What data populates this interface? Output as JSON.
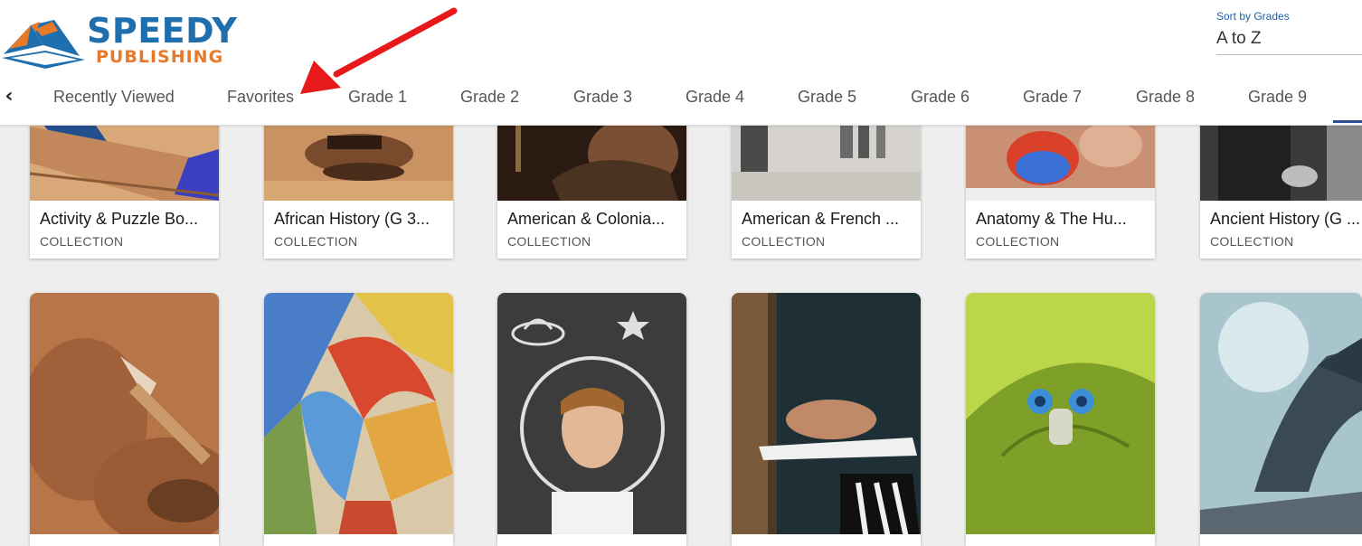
{
  "logo": {
    "line1": "SPEEDY",
    "line2": "PUBLISHING"
  },
  "sort": {
    "label": "Sort by Grades",
    "value": "A to Z"
  },
  "tabs": [
    "Recently Viewed",
    "Favorites",
    "Grade 1",
    "Grade 2",
    "Grade 3",
    "Grade 4",
    "Grade 5",
    "Grade 6",
    "Grade 7",
    "Grade 8",
    "Grade 9"
  ],
  "collections": [
    {
      "title": "Activity & Puzzle Bo...",
      "type": "COLLECTION"
    },
    {
      "title": "African History (G 3...",
      "type": "COLLECTION"
    },
    {
      "title": "American & Colonia...",
      "type": "COLLECTION"
    },
    {
      "title": "American & French ...",
      "type": "COLLECTION"
    },
    {
      "title": "Anatomy & The Hu...",
      "type": "COLLECTION"
    },
    {
      "title": "Ancient History (G ...",
      "type": "COLLECTION"
    }
  ],
  "colors": {
    "brand_blue": "#1f6fae",
    "brand_orange": "#e8792b",
    "annotation_red": "#e8191a",
    "tab_indicator": "#2e4d8f"
  }
}
